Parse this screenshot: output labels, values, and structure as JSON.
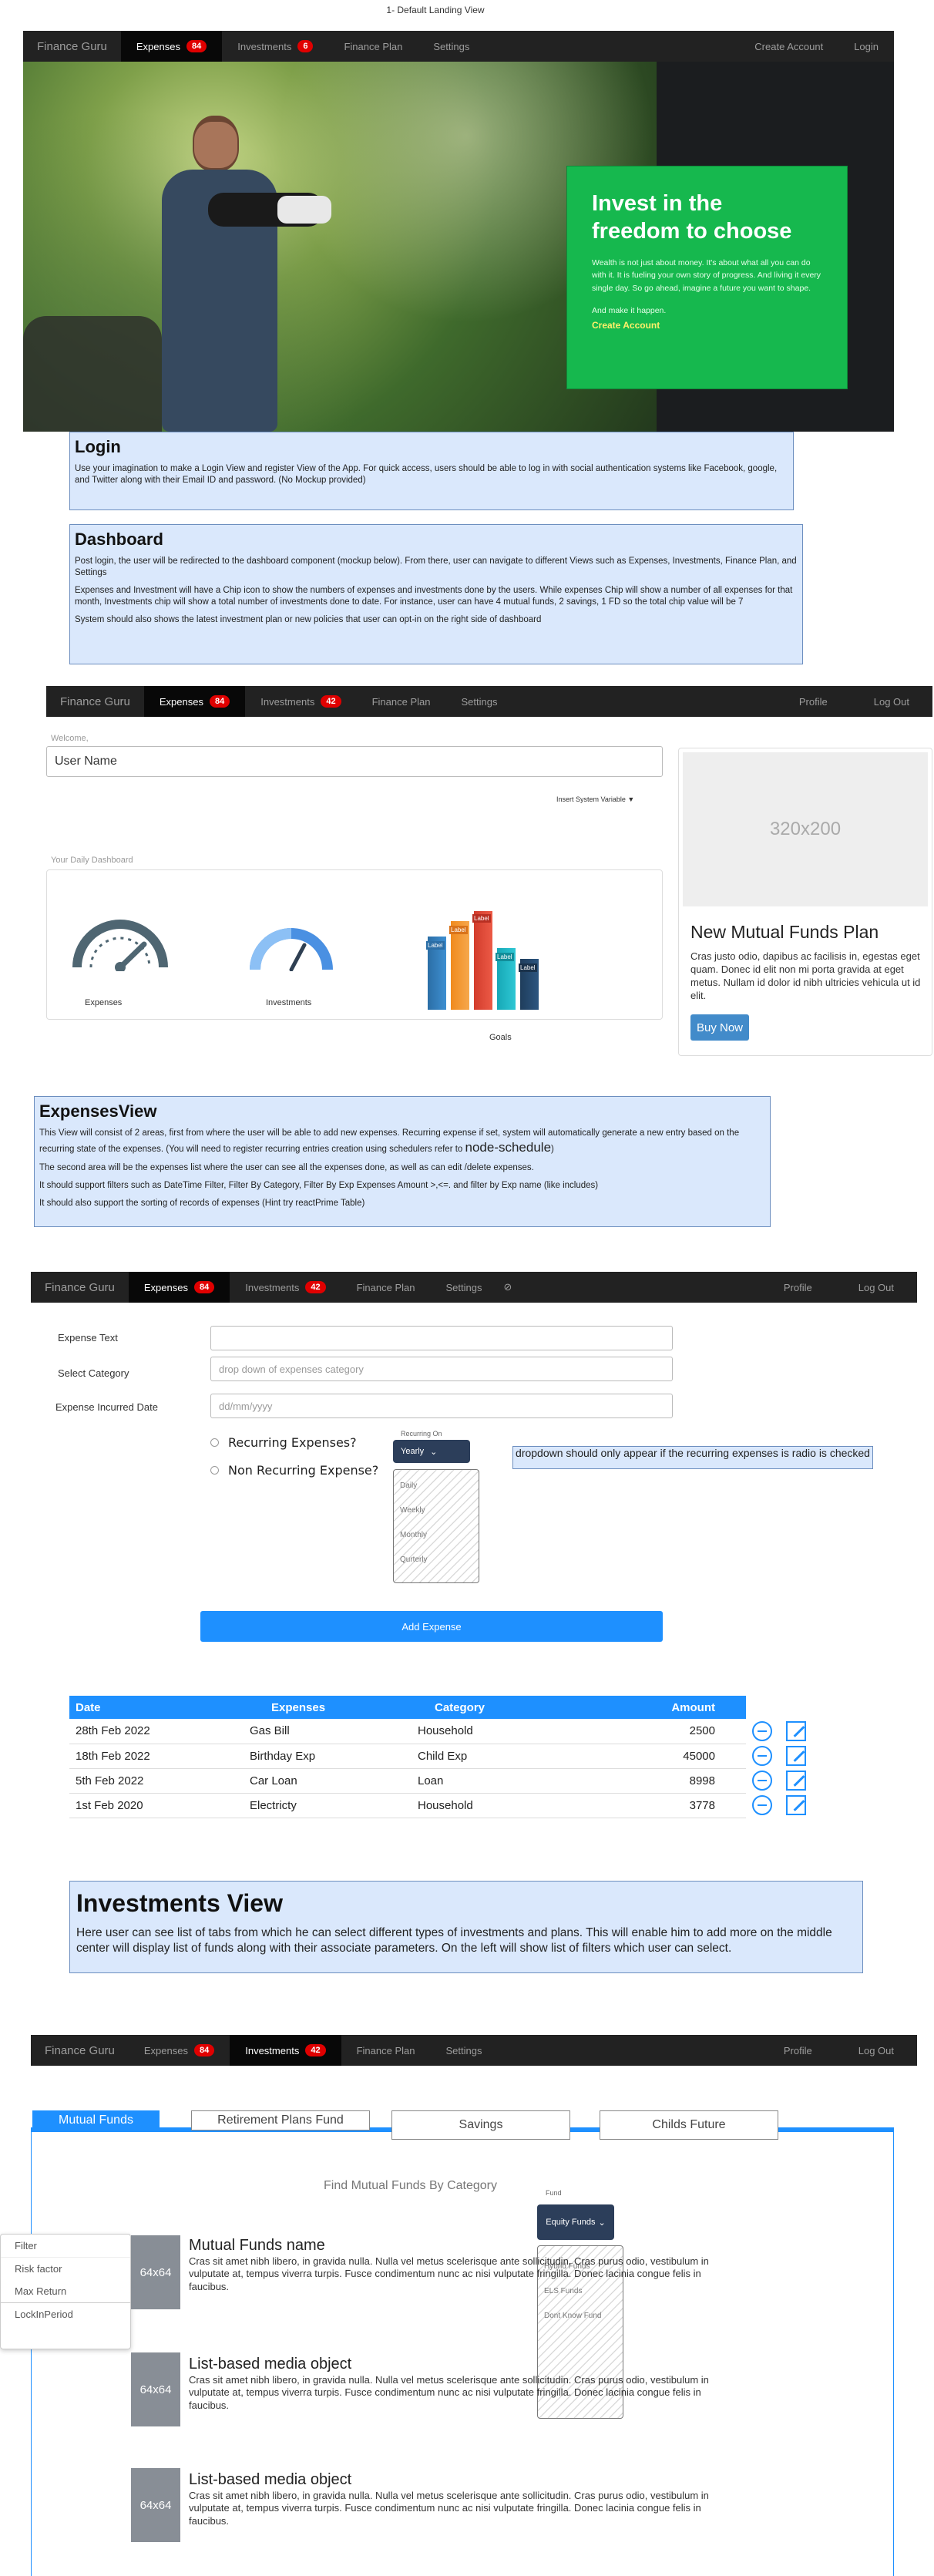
{
  "page_caption": "1- Default Landing View",
  "nav1": {
    "brand": "Finance Guru",
    "items": [
      {
        "label": "Expenses",
        "badge": "84"
      },
      {
        "label": "Investments",
        "badge": "6"
      },
      {
        "label": "Finance Plan"
      },
      {
        "label": "Settings"
      }
    ],
    "right": [
      "Create Account",
      "Login"
    ]
  },
  "hero": {
    "title": "Invest in the freedom to choose",
    "body": "Wealth is not just about money. It's about what all you can do with it. It is fueling your own story of progress. And living it every single day. So go ahead, imagine a future you want to shape.",
    "cta_text": "And make it happen.",
    "cta_link": "Create Account"
  },
  "login_note": {
    "title": "Login",
    "body": "Use your imagination to make a Login View and register View of the App. For quick access, users should be able to log in with social authentication systems like Facebook, google, and Twitter along with their Email ID and password. (No Mockup provided)"
  },
  "dashboard_note": {
    "title": "Dashboard",
    "p1": "Post login, the user will be redirected to the dashboard component (mockup below). From there, user can navigate to  different Views such as Expenses, Investments, Finance Plan, and Settings",
    "p2": "Expenses and Investment will have a Chip icon to show the numbers of expenses and investments done by the users. While expenses Chip will show a number of all expenses for that month, Investments chip will show a total number of investments done to date. For instance, user can have 4 mutual funds, 2 savings, 1 FD so the total chip value will be 7",
    "p3": "System should also shows the latest investment plan or new policies that user can opt-in on the right side of dashboard"
  },
  "nav2": {
    "brand": "Finance Guru",
    "items": [
      {
        "label": "Expenses",
        "badge": "84"
      },
      {
        "label": "Investments",
        "badge": "42"
      },
      {
        "label": "Finance Plan"
      },
      {
        "label": "Settings"
      }
    ],
    "right": [
      "Profile",
      "Log Out"
    ]
  },
  "dashboard": {
    "welcome": "Welcome,",
    "user_name": "User Name",
    "insert_var": "Insert System Variable",
    "daily_label": "Your Daily Dashboard",
    "widgets": [
      "Expenses",
      "Investments",
      "Goals"
    ],
    "bar_labels": [
      "Label",
      "Label",
      "Label",
      "Label",
      "Label"
    ],
    "side_img": "320x200",
    "side_title": "New Mutual Funds Plan",
    "side_body": "Cras justo odio, dapibus ac facilisis in, egestas eget quam. Donec id elit non mi porta gravida at eget metus. Nullam id dolor id nibh ultricies vehicula ut id elit.",
    "side_button": "Buy Now"
  },
  "expenses_note": {
    "title": "ExpensesView",
    "p1a": "This View will consist of 2 areas, first from where the user will be able to add  new expenses. Recurring expense if set, system will automatically generate a new entry based on the recurring state of the expenses. (You will need to register recurring entries creation using schedulers  refer to ",
    "p1b": "node-schedule",
    "p1c": ")",
    "p2": "The second area will be the expenses list where the user can see all the expenses done, as well as can edit /delete expenses.",
    "p3": "It should support filters such as DateTime Filter, Filter By Category, Filter By Exp Expenses Amount >,<=. and filter by Exp name (like includes)",
    "p4": "It should also support the sorting of records of expenses (Hint try reactPrime Table)"
  },
  "nav3": {
    "brand": "Finance Guru",
    "items": [
      {
        "label": "Expenses",
        "badge": "84"
      },
      {
        "label": "Investments",
        "badge": "42"
      },
      {
        "label": "Finance Plan"
      },
      {
        "label": "Settings"
      }
    ],
    "right": [
      "Profile",
      "Log Out"
    ]
  },
  "expense_form": {
    "labels": [
      "Expense Text",
      "Select Category",
      "Expense Incurred Date"
    ],
    "category_placeholder": "drop down of expenses category",
    "date_placeholder": "dd/mm/yyyy",
    "radio1": "Recurring Expenses?",
    "radio2": "Non Recurring Expense?",
    "recurring_on": "Recurring On",
    "select_value": "Yearly",
    "options": [
      "Daily",
      "Weekly",
      "Monthly",
      "Qurterly"
    ],
    "callout": "dropdown should only appear if the recurring expenses is radio is checked",
    "add_button": "Add Expense"
  },
  "expense_table": {
    "headers": [
      "Date",
      "Expenses",
      "Category",
      "Amount"
    ],
    "rows": [
      [
        "28th Feb 2022",
        "Gas Bill",
        "Household",
        "2500"
      ],
      [
        "18th Feb 2022",
        "Birthday Exp",
        "Child Exp",
        "45000"
      ],
      [
        "5th Feb 2022",
        "Car Loan",
        "Loan",
        "8998"
      ],
      [
        "1st Feb 2020",
        "Electricty",
        "Household",
        "3778"
      ]
    ]
  },
  "investments_note": {
    "title": "Investments View",
    "body": "Here user can see list of tabs from which he can select different types of investments and plans. This will enable him to add more on the middle center will display list of funds along with their associate parameters. On the left will show list of filters which user can select."
  },
  "nav4": {
    "brand": "Finance Guru",
    "items": [
      {
        "label": "Expenses",
        "badge": "84"
      },
      {
        "label": "Investments",
        "badge": "42"
      },
      {
        "label": "Finance Plan"
      },
      {
        "label": "Settings"
      }
    ],
    "right": [
      "Profile",
      "Log Out"
    ]
  },
  "investments": {
    "tabs": [
      "Mutual Funds",
      "Retirement Plans Fund",
      "Savings",
      "Childs Future"
    ],
    "heading": "Find Mutual Funds By Category",
    "fund_label": "Fund",
    "fund_select": "Equity Funds",
    "fund_options": [
      "Hybrid Funds",
      "ELS Funds",
      "Dont Know Fund"
    ],
    "filters": [
      "Filter",
      "Risk factor",
      "Max Return",
      "LockInPeriod"
    ],
    "media": [
      {
        "thumb": "64x64",
        "title": "Mutual Funds name",
        "body": "Cras sit amet nibh libero, in gravida nulla. Nulla vel metus scelerisque ante sollicitudin. Cras purus odio, vestibulum in vulputate at, tempus viverra turpis. Fusce condimentum nunc ac nisi vulputate fringilla. Donec lacinia congue felis in faucibus."
      },
      {
        "thumb": "64x64",
        "title": "List-based media object",
        "body": "Cras sit amet nibh libero, in gravida nulla. Nulla vel metus scelerisque ante sollicitudin. Cras purus odio, vestibulum in vulputate at, tempus viverra turpis. Fusce condimentum nunc ac nisi vulputate fringilla. Donec lacinia congue felis in faucibus."
      },
      {
        "thumb": "64x64",
        "title": "List-based media object",
        "body": "Cras sit amet nibh libero, in gravida nulla. Nulla vel metus scelerisque ante sollicitudin. Cras purus odio, vestibulum in vulputate at, tempus viverra turpis. Fusce condimentum nunc ac nisi vulputate fringilla. Donec lacinia congue felis in faucibus."
      }
    ]
  },
  "colors": {
    "nav_bg": "#222222",
    "badge": "#e00000",
    "hero_card": "#16b84e",
    "note_bg": "#dae8fc",
    "note_border": "#6c8ebf",
    "primary": "#1e90ff",
    "buy_button": "#428bca"
  }
}
